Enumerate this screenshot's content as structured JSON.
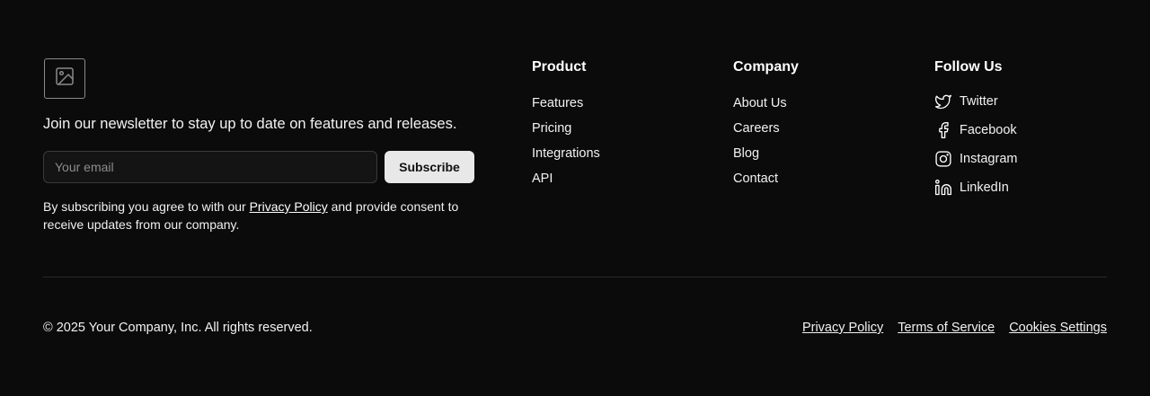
{
  "brand": {
    "logo_icon": "image-placeholder-icon"
  },
  "newsletter": {
    "tagline": "Join our newsletter to stay up to date on features and releases.",
    "email_placeholder": "Your email",
    "email_value": "",
    "subscribe_label": "Subscribe",
    "consent_before": "By subscribing you agree to with our ",
    "consent_link": "Privacy Policy",
    "consent_after": " and provide consent to receive updates from our company."
  },
  "columns": {
    "product": {
      "title": "Product",
      "items": [
        "Features",
        "Pricing",
        "Integrations",
        "API"
      ]
    },
    "company": {
      "title": "Company",
      "items": [
        "About Us",
        "Careers",
        "Blog",
        "Contact"
      ]
    },
    "follow": {
      "title": "Follow Us",
      "items": [
        {
          "label": "Twitter",
          "icon": "twitter-icon"
        },
        {
          "label": "Facebook",
          "icon": "facebook-icon"
        },
        {
          "label": "Instagram",
          "icon": "instagram-icon"
        },
        {
          "label": "LinkedIn",
          "icon": "linkedin-icon"
        }
      ]
    }
  },
  "bottom": {
    "copyright": "© 2025 Your Company, Inc. All rights reserved.",
    "links": [
      "Privacy Policy",
      "Terms of Service",
      "Cookies Settings"
    ]
  },
  "colors": {
    "background": "#0b0b0b",
    "text": "#ffffff",
    "button_bg": "#e8e8e8",
    "input_bg": "#141414",
    "divider": "#2a2a2a"
  }
}
